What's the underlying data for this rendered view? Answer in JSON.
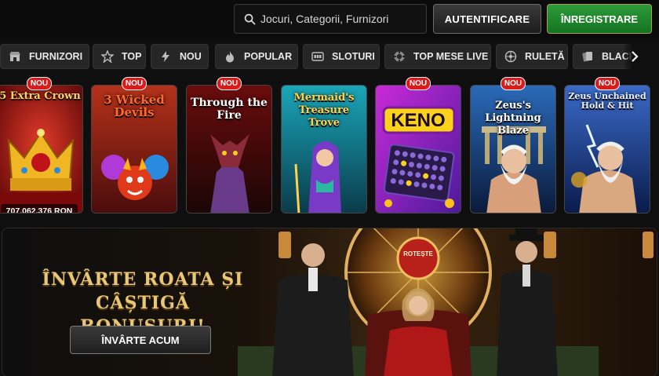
{
  "header": {
    "search_placeholder": "Jocuri, Categorii, Furnizori",
    "login_label": "AUTENTIFICARE",
    "register_label": "ÎNREGISTRARE"
  },
  "categories": [
    {
      "label": "FURNIZORI",
      "icon": "store-icon"
    },
    {
      "label": "TOP",
      "icon": "star-icon"
    },
    {
      "label": "NOU",
      "icon": "lightning-icon"
    },
    {
      "label": "POPULAR",
      "icon": "fire-icon"
    },
    {
      "label": "SLOTURI",
      "icon": "slot-machine-icon"
    },
    {
      "label": "TOP MESE LIVE",
      "icon": "poker-chip-icon"
    },
    {
      "label": "RULETĂ",
      "icon": "roulette-icon"
    },
    {
      "label": "BLACKJACK",
      "icon": "cards-icon"
    }
  ],
  "games": [
    {
      "title": "5 Extra Crown",
      "badge": "NOU",
      "jackpot": "707,062.376 RON"
    },
    {
      "title": "3 Wicked Devils",
      "badge": "NOU"
    },
    {
      "title": "Through the Fire",
      "badge": "NOU"
    },
    {
      "title": "Mermaid's Treasure Trove",
      "badge": ""
    },
    {
      "title": "KENO",
      "badge": "NOU"
    },
    {
      "title": "Zeus's Lightning Blaze",
      "badge": "NOU"
    },
    {
      "title": "Zeus Unchained Hold & Hit",
      "badge": "NOU"
    }
  ],
  "promo": {
    "title_line1": "ÎNVÂRTE ROATA ȘI CÂȘTIGĂ",
    "title_line2": "BONUSURI!",
    "button_label": "ÎNVÂRTE ACUM",
    "wheel_label": "ROTEȘTE"
  },
  "colors": {
    "accent_gold": "#e8c778",
    "register_green": "#1f8a2e",
    "badge_red": "#d81b1b"
  }
}
